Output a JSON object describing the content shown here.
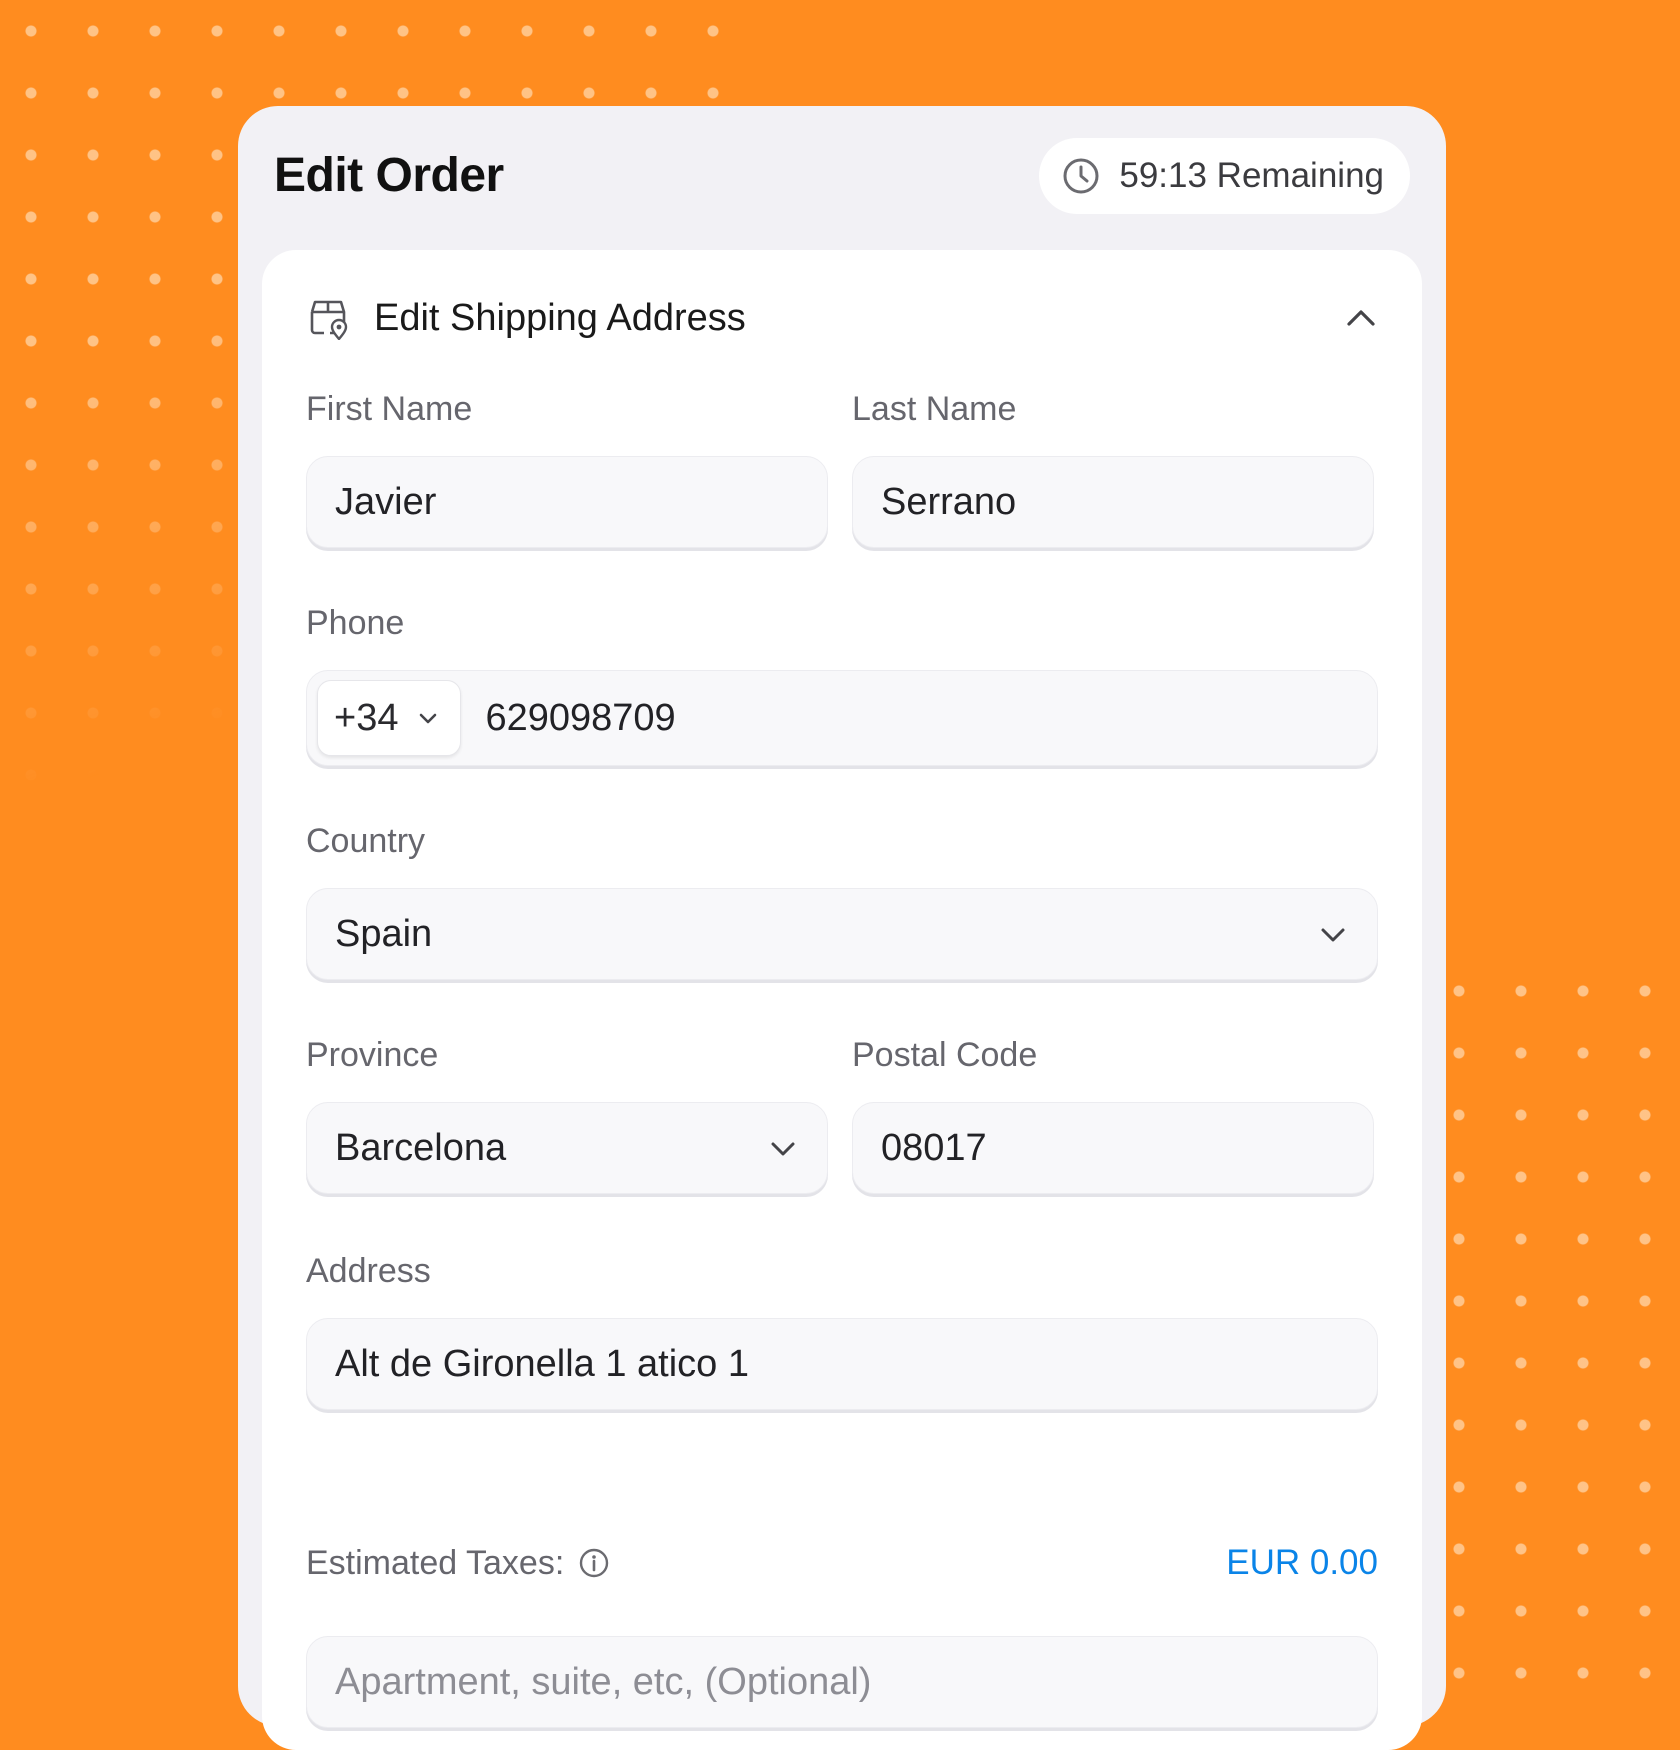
{
  "header": {
    "title": "Edit Order",
    "timer_text": "59:13 Remaining",
    "timer_icon": "clock-icon"
  },
  "section": {
    "title": "Edit Shipping Address",
    "icon": "shipping-box-location-icon",
    "collapse_icon": "chevron-up-icon"
  },
  "form": {
    "first_name": {
      "label": "First Name",
      "value": "Javier"
    },
    "last_name": {
      "label": "Last Name",
      "value": "Serrano"
    },
    "phone": {
      "label": "Phone",
      "country_code": "+34",
      "value": "629098709"
    },
    "country": {
      "label": "Country",
      "value": "Spain"
    },
    "province": {
      "label": "Province",
      "value": "Barcelona"
    },
    "postal_code": {
      "label": "Postal Code",
      "value": "08017"
    },
    "address": {
      "label": "Address",
      "value": "Alt de Gironella 1 atico 1"
    },
    "taxes": {
      "label": "Estimated Taxes:",
      "amount": "EUR 0.00"
    },
    "apartment": {
      "placeholder": "Apartment, suite, etc, (Optional)"
    }
  },
  "colors": {
    "background": "#ff8c1f",
    "accent": "#0a84e8",
    "card": "#f2f1f5"
  }
}
